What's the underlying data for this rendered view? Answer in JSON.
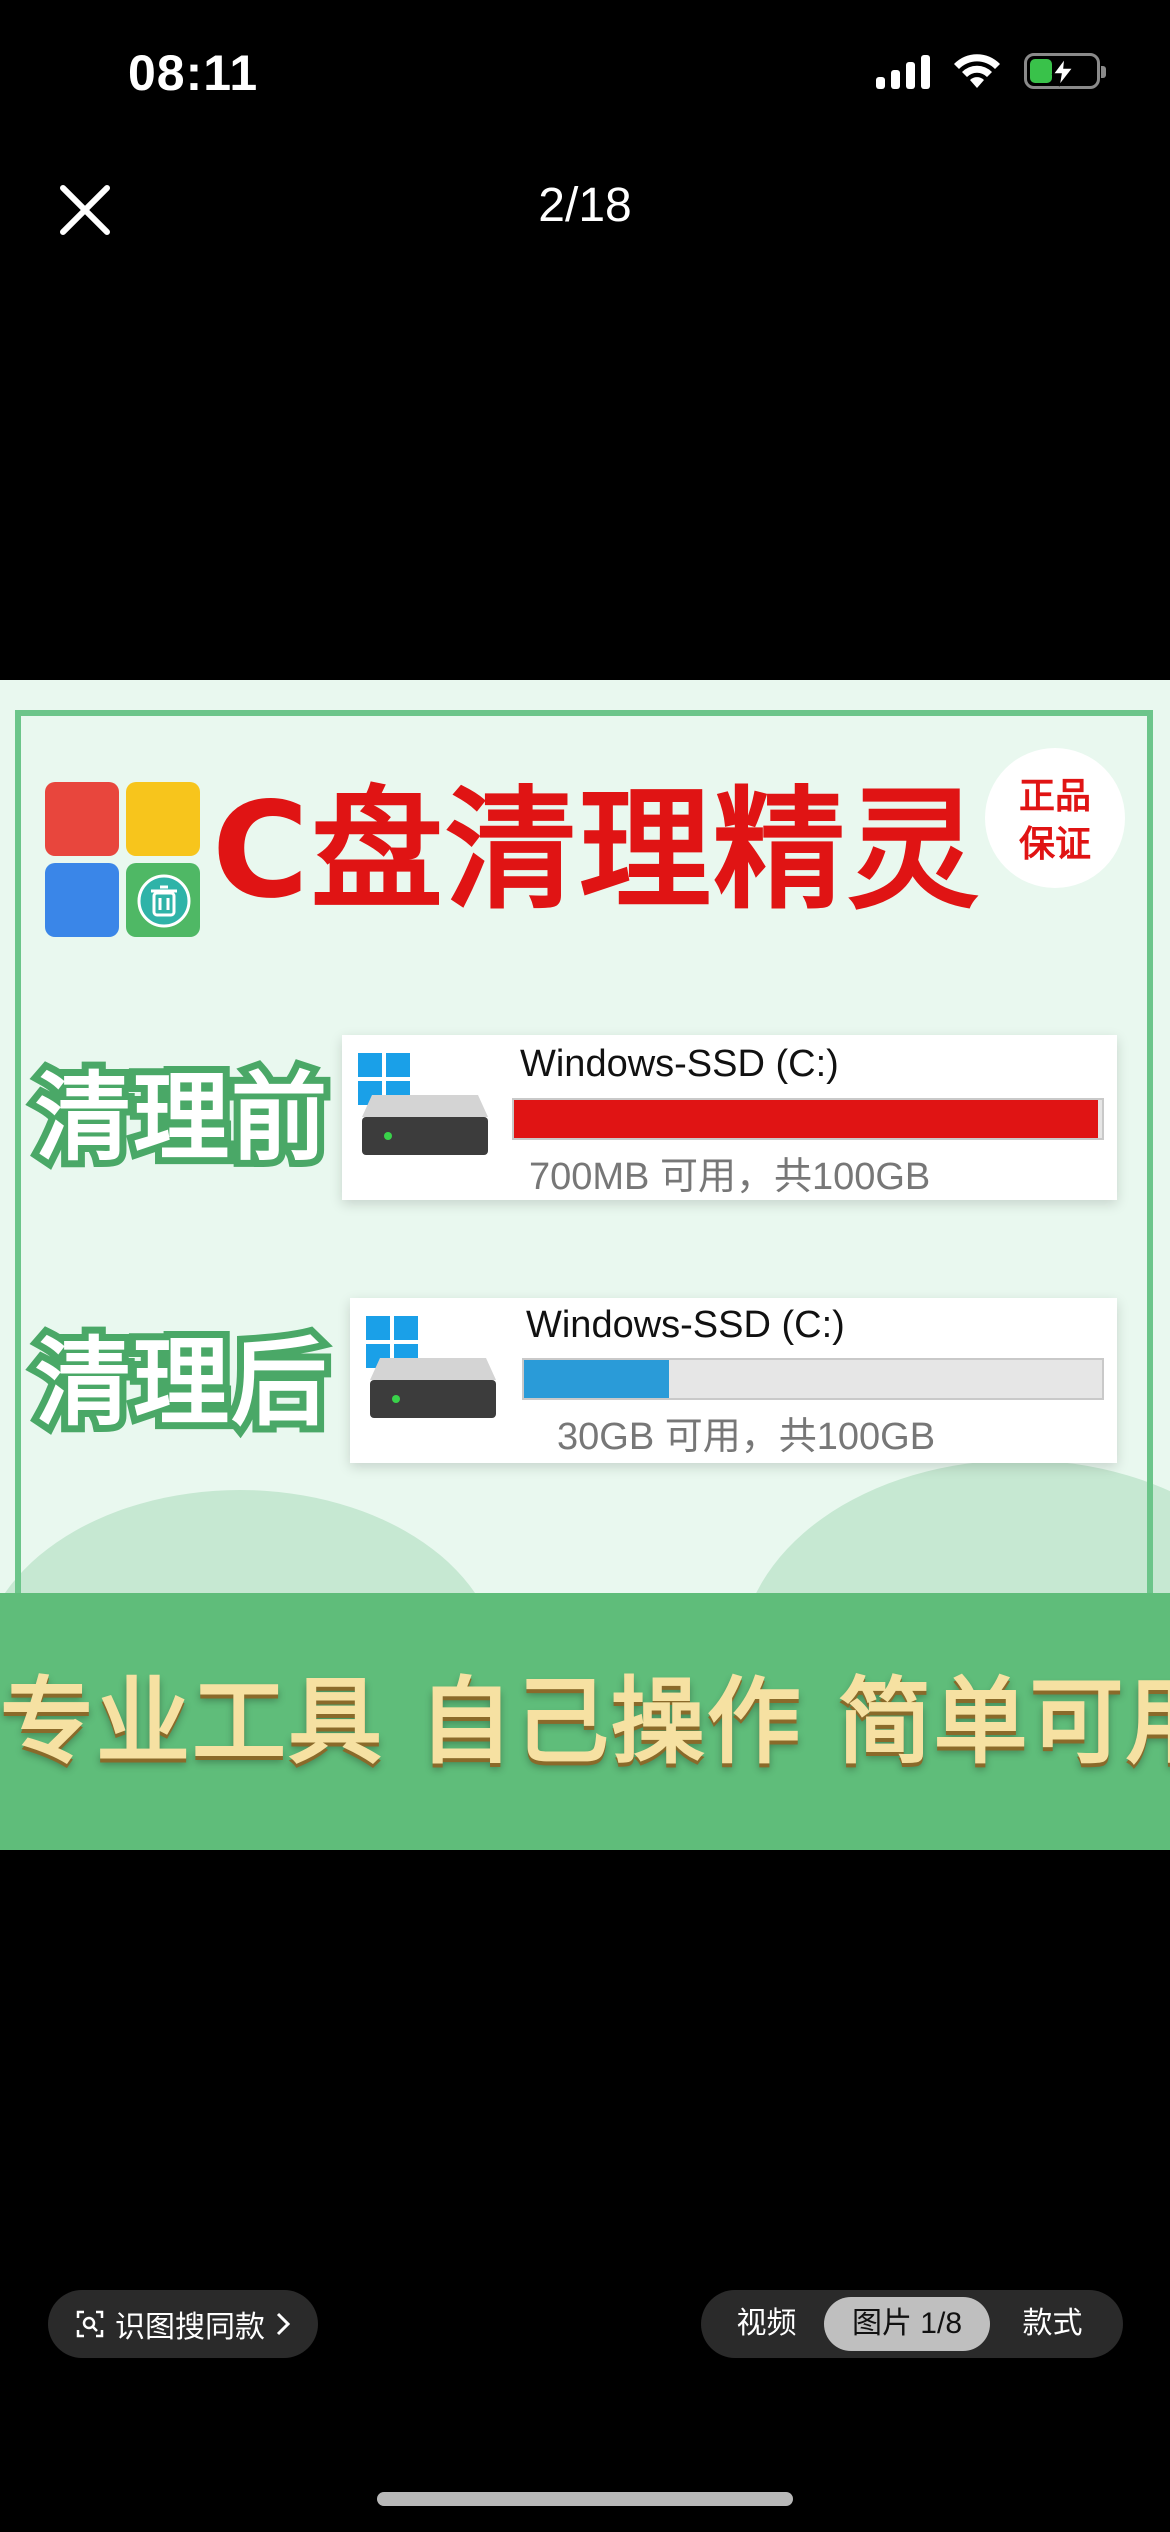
{
  "status_bar": {
    "time": "08:11"
  },
  "viewer": {
    "page_counter": "2/18"
  },
  "promo": {
    "title": "C盘清理精灵",
    "badge_line1": "正品",
    "badge_line2": "保证",
    "before": {
      "label": "清理前",
      "drive_name": "Windows-SSD (C:)",
      "info": "700MB 可用，共100GB",
      "usage_fraction": 0.993,
      "bar_color": "#e01414"
    },
    "after": {
      "label": "清理后",
      "drive_name": "Windows-SSD (C:)",
      "info": "30GB 可用，共100GB",
      "usage_fraction": 0.25,
      "bar_color": "#2a9bd8"
    },
    "slogan": "专业工具 自己操作 简单可用"
  },
  "bottom_bar": {
    "find_similar_label": "识图搜同款",
    "tabs": [
      {
        "label": "视频",
        "active": false
      },
      {
        "label": "图片 1/8",
        "active": true
      },
      {
        "label": "款式",
        "active": false
      }
    ]
  },
  "colors": {
    "brand_green": "#5fbd7a",
    "title_red": "#e01414",
    "frame_green": "#6cc58a"
  }
}
